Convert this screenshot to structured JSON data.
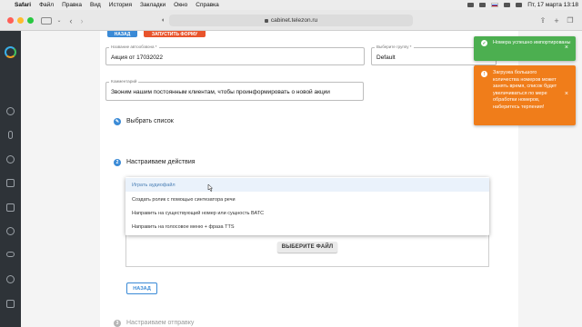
{
  "menubar": {
    "items": [
      "Safari",
      "Файл",
      "Правка",
      "Вид",
      "История",
      "Закладки",
      "Окно",
      "Справка"
    ],
    "clock": "Пт, 17 марта  13:18"
  },
  "browser": {
    "url": "cabinet.telezon.ru"
  },
  "top_buttons": {
    "left": "НАЗАД",
    "right": "ЗАПУСТИТЬ ФОРМУ"
  },
  "form": {
    "name_label": "Название автообзвона *",
    "name_value": "Акция от 17032022",
    "group_label": "Выберите группу *",
    "group_value": "Default",
    "comment_label": "Комментарий",
    "comment_value": "Звоним нашим постоянным клиентам, чтобы проинформировать о новой акции"
  },
  "steps": {
    "choose_list": "Выбрать список",
    "configure_actions_num": "2",
    "configure_actions": "Настраиваем действия",
    "configure_sending_num": "3",
    "configure_sending": "Настраиваем отправку"
  },
  "dropdown": {
    "items": [
      "Играть аудиофайл",
      "Создать ролик с помощью синтезатора речи",
      "Направить на существующий номер или сущность ВАТС",
      "Направить на голосовое меню + фраза TTS"
    ]
  },
  "buttons": {
    "select_file": "ВЫБЕРИТЕ ФАЙЛ",
    "back": "НАЗАД"
  },
  "toasts": {
    "success": "Номера успешно импортированы",
    "warning": "Загрузка большого количества номеров может занять время, список будет увеличиваться по мере обработки номеров, наберитесь терпения!",
    "success_color": "#4caf50",
    "warning_color": "#f07d1a"
  },
  "colors": {
    "accent": "#3a8ad6",
    "sidebar": "#2e3338"
  }
}
